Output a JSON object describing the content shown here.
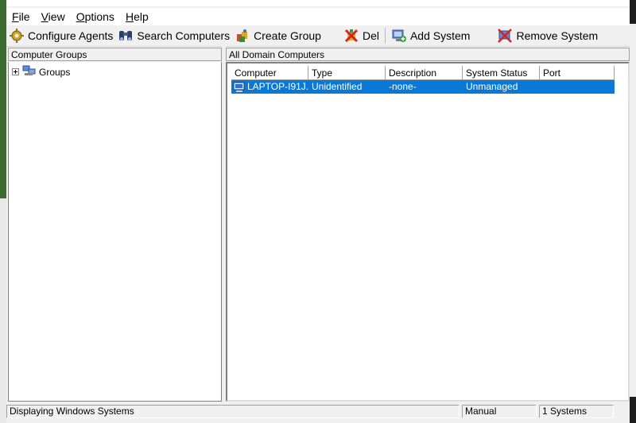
{
  "menu": {
    "items": [
      {
        "label": "File",
        "underline": "F",
        "rest": "ile"
      },
      {
        "label": "View",
        "underline": "V",
        "rest": "iew"
      },
      {
        "label": "Options",
        "underline": "O",
        "rest": "ptions"
      },
      {
        "label": "Help",
        "underline": "H",
        "rest": "elp"
      }
    ]
  },
  "toolbar": {
    "configure_agents": "Configure Agents",
    "search_computers": "Search Computers",
    "create_group": "Create Group",
    "delete": "Del",
    "add_system": "Add System",
    "remove_system": "Remove System"
  },
  "left_pane": {
    "header": "Computer Groups",
    "tree_root": "Groups"
  },
  "right_pane": {
    "header": "All Domain Computers",
    "columns": [
      "Computer",
      "Type",
      "Description",
      "System Status",
      "Port"
    ],
    "rows": [
      {
        "computer": "LAPTOP-I91J...",
        "type": "Unidentified",
        "description": "-none-",
        "system_status": "Unmanaged",
        "port": ""
      }
    ]
  },
  "status_bar": {
    "message": "Displaying Windows Systems",
    "mode": "Manual",
    "count": "1 Systems"
  },
  "colors": {
    "selection": "#0a78d7",
    "window_bg": "#f0f0f0"
  }
}
